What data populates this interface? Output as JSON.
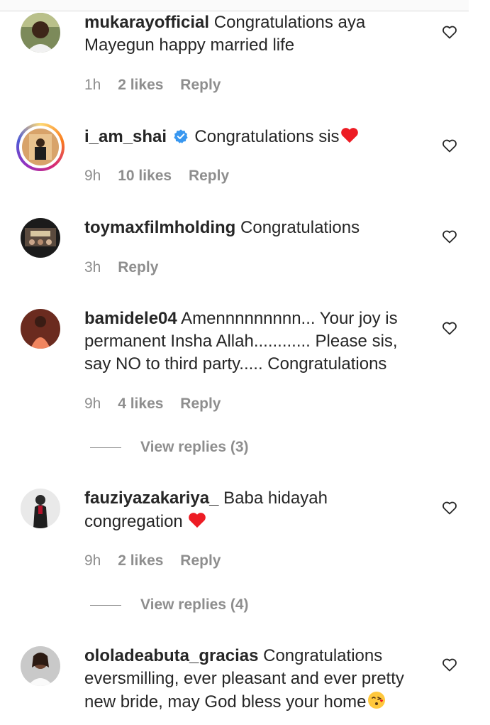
{
  "comments": [
    {
      "username": "mukarayofficial",
      "text": "Congratulations aya Mayegun happy married life",
      "time": "1h",
      "likes": "2 likes",
      "reply": "Reply",
      "verified": false
    },
    {
      "username": "i_am_shai",
      "text": "Congratulations sis",
      "time": "9h",
      "likes": "10 likes",
      "reply": "Reply",
      "verified": true
    },
    {
      "username": "toymaxfilmholding",
      "text": "Congratulations",
      "time": "3h",
      "likes": "",
      "reply": "Reply",
      "verified": false
    },
    {
      "username": "bamidele04",
      "text": "Amennnnnnnnn... Your joy is permanent Insha Allah............ Please sis, say NO to third party..... Congratulations",
      "time": "9h",
      "likes": "4 likes",
      "reply": "Reply",
      "verified": false
    },
    {
      "username": "fauziyazakariya_",
      "text": "Baba hidayah congregation",
      "time": "9h",
      "likes": "2 likes",
      "reply": "Reply",
      "verified": false
    },
    {
      "username": "ololadeabuta_gracias",
      "text": "Congratulations eversmilling, ever pleasant and ever pretty new bride, may God bless your home",
      "verified": false
    }
  ],
  "view_replies": {
    "bamidele04": "View replies (3)",
    "fauziyazakariya_": "View replies (4)"
  },
  "icons": {
    "like": "heart-outline-icon",
    "verified": "verified-badge-icon",
    "heart_emoji": "red-heart-emoji",
    "kiss_emoji": "face-blowing-kiss-emoji"
  },
  "colors": {
    "text": "#262626",
    "secondary": "#8e8e8e",
    "verified": "#3897f0",
    "heart_emoji": "#ed1c24"
  }
}
